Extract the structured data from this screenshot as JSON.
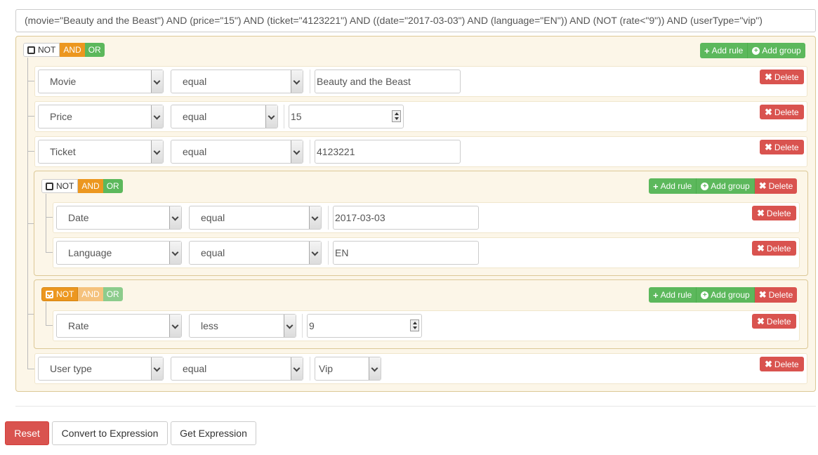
{
  "expression": "(movie=\"Beauty and the Beast\") AND (price=\"15\") AND (ticket=\"4123221\") AND ((date=\"2017-03-03\") AND (language=\"EN\")) AND (NOT (rate<\"9\")) AND (userType=\"vip\")",
  "condition": {
    "not": "NOT",
    "and": "AND",
    "or": "OR"
  },
  "actions": {
    "add_rule": "Add rule",
    "add_group": "Add group",
    "delete": "Delete"
  },
  "rules": {
    "movie": {
      "field": "Movie",
      "operator": "equal",
      "value": "Beauty and the Beast"
    },
    "price": {
      "field": "Price",
      "operator": "equal",
      "value": "15"
    },
    "ticket": {
      "field": "Ticket",
      "operator": "equal",
      "value": "4123221"
    },
    "date": {
      "field": "Date",
      "operator": "equal",
      "value": "2017-03-03"
    },
    "language": {
      "field": "Language",
      "operator": "equal",
      "value": "EN"
    },
    "rate": {
      "field": "Rate",
      "operator": "less",
      "value": "9"
    },
    "usertype": {
      "field": "User type",
      "operator": "equal",
      "value": "Vip"
    }
  },
  "footer": {
    "reset": "Reset",
    "convert": "Convert to Expression",
    "get": "Get Expression"
  },
  "colors": {
    "and": "#ec971f",
    "or": "#5cb85c",
    "danger": "#d9534f",
    "group_bg": "#fcf6e8"
  }
}
